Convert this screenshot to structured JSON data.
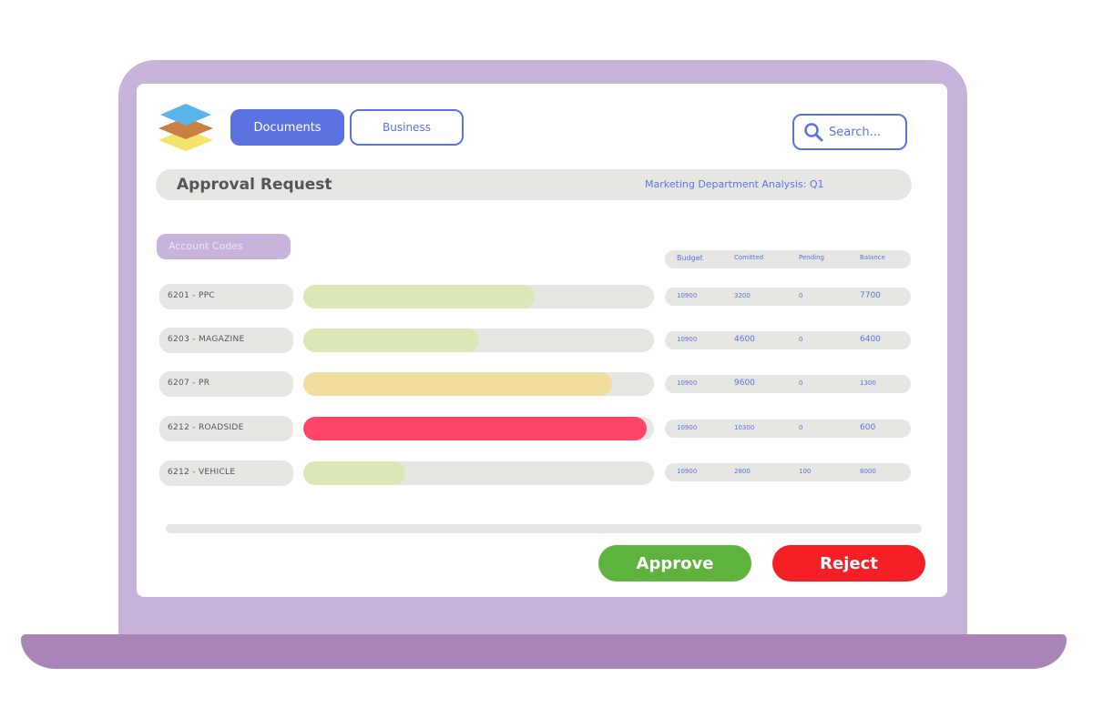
{
  "header": {
    "tabs": [
      {
        "label": "Documents",
        "active": true
      },
      {
        "label": "Business",
        "active": false
      }
    ],
    "search": {
      "placeholder": "Search..."
    }
  },
  "title_bar": {
    "title": "Approval Request",
    "subtitle": "Marketing Department Analysis: Q1"
  },
  "table": {
    "section_label": "Account Codes",
    "columns": [
      "Budget",
      "Comitted",
      "Pending",
      "Balance"
    ],
    "rows": [
      {
        "code": "6201 - PPC",
        "progress": 0.66,
        "color": "#dbe8b6",
        "values": [
          "10900",
          "3200",
          "0",
          "7700"
        ]
      },
      {
        "code": "6203 - MAGAZINE",
        "progress": 0.5,
        "color": "#dbe8b6",
        "values": [
          "10900",
          "4600",
          "0",
          "6400"
        ]
      },
      {
        "code": "6207 - PR",
        "progress": 0.88,
        "color": "#f1de9f",
        "values": [
          "10900",
          "9600",
          "0",
          "1300"
        ]
      },
      {
        "code": "6212 - ROADSIDE",
        "progress": 0.98,
        "color": "#ff4568",
        "values": [
          "10900",
          "10300",
          "0",
          "600"
        ]
      },
      {
        "code": "6212 - VEHICLE",
        "progress": 0.29,
        "color": "#dbe8b6",
        "values": [
          "10900",
          "2800",
          "100",
          "8000"
        ]
      }
    ]
  },
  "actions": {
    "approve": "Approve",
    "reject": "Reject"
  },
  "colors": {
    "accent": "#5b73e0",
    "frame": "#c8b4da",
    "approve": "#5db33e",
    "reject": "#f51f26"
  }
}
